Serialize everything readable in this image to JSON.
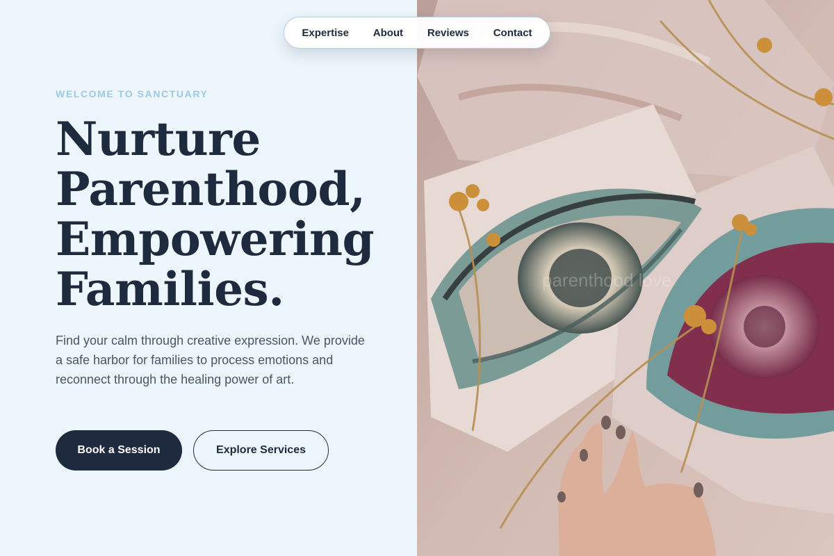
{
  "nav": {
    "items": [
      {
        "label": "Expertise"
      },
      {
        "label": "About"
      },
      {
        "label": "Reviews"
      },
      {
        "label": "Contact"
      }
    ]
  },
  "hero": {
    "eyebrow": "WELCOME TO SANCTUARY",
    "headline_lines": [
      "Nurture",
      "Parenthood,",
      "Empowering",
      "Families."
    ],
    "description": "Find your calm through creative expression. We provide a safe harbor for families to process emotions and reconnect through the healing power of art.",
    "primary_button": "Book a Session",
    "secondary_button": "Explore Services"
  },
  "image": {
    "watermark": "parenthood love"
  },
  "colors": {
    "background": "#eef6fd",
    "navy": "#1e2a3e",
    "eyebrow": "#9cc9e8",
    "body_text": "#4a5666"
  }
}
